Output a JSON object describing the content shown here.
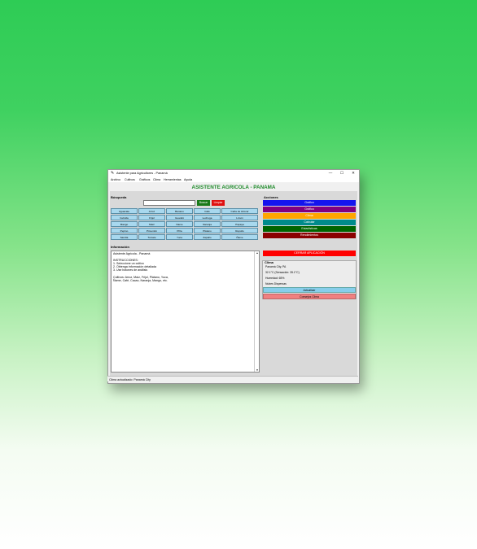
{
  "window": {
    "title": "Asistente para Agricultores - Panamá",
    "minimize": "—",
    "maximize": "☐",
    "close": "✕"
  },
  "menu": [
    "Archivo",
    "Cultivos",
    "Gráficos",
    "Clima",
    "Herramientas",
    "Ayuda"
  ],
  "app_title": "ASISTENTE AGRICOLA - PANAMA",
  "busqueda": {
    "label": "Búsqueda",
    "input_value": "",
    "buscar": "Buscar",
    "limpiar": "Limpiar"
  },
  "crops": [
    [
      "Aguacate",
      "Arroz",
      "Banano",
      "Café",
      "Caña de Azúcar"
    ],
    [
      "Cebolla",
      "Frijol",
      "Guandú",
      "Lechuga",
      "Limón"
    ],
    [
      "Mango",
      "Maíz",
      "Name",
      "Naranja",
      "Papaya"
    ],
    [
      "Pepino",
      "Pimentón",
      "Piña",
      "Plátano",
      "Repollo"
    ],
    [
      "Sandía",
      "Tomate",
      "Yuca",
      "Zapallo",
      "Ñame"
    ]
  ],
  "informacion": {
    "label": "Información",
    "lines": [
      "Asistente Agrícola - Panamá",
      "",
      "INSTRUCCIONES:",
      "1. Seleccione un cultivo",
      "2. Obtenga información detallada",
      "3. Use botones de análisis",
      "",
      "Cultivos: Arroz, Maíz, Frijol, Plátano, Yuca,",
      "Ñame, Café, Cacao, Naranja, Mango, etc."
    ]
  },
  "acciones": {
    "label": "Acciones",
    "buttons": [
      {
        "label": "Gráfico",
        "color": "#1414ee"
      },
      {
        "label": "Gráfico",
        "color": "#800080"
      },
      {
        "label": "Clima",
        "color": "#ffa500"
      },
      {
        "label": "Calcular",
        "color": "#008b8b"
      },
      {
        "label": "Estadísticas",
        "color": "#006400"
      },
      {
        "label": "Rendimientos",
        "color": "#8b0000"
      }
    ],
    "cerrar": "CERRAR APLICACIÓN",
    "cerrar_color": "#ff0000"
  },
  "clima": {
    "label": "Clima",
    "lines": [
      "Panamá City, PA",
      "32.1°C (Sensación: 35.1°C)",
      "Humedad: 65%",
      "Nubes Dispersas"
    ],
    "actualizar": "Actualizar",
    "consejos": "Consejos Clima"
  },
  "status": "Clima actualizado: Panamá City",
  "colors": {
    "title_green": "#1f8b2b",
    "crop_button": "#a8d8ee"
  }
}
